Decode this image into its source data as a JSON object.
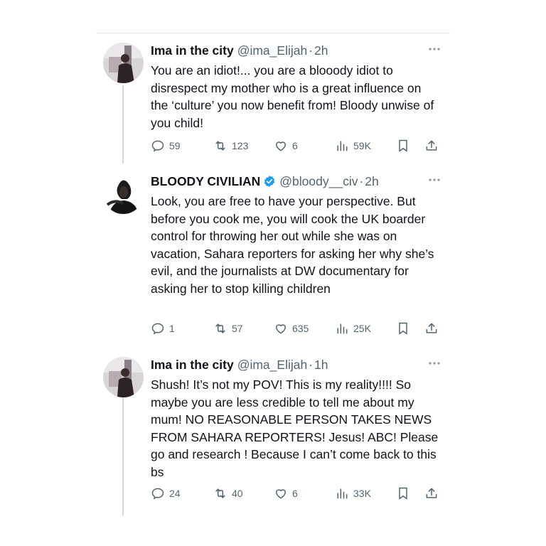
{
  "tweets": [
    {
      "name": "Ima in the city",
      "handle": "@ima_Elijah",
      "time": "2h",
      "verified": false,
      "text": "You are an idiot!... you are a blooody idiot to disrespect my mother who is a great influence on the ‘culture’ you now benefit from! Bloody unwise of you child!",
      "replies": "59",
      "reposts": "123",
      "likes": "6",
      "views": "59K"
    },
    {
      "name": "BLOODY CIVILIAN",
      "handle": "@bloody__civ",
      "time": "2h",
      "verified": true,
      "text": "Look, you are free to have your perspective. But before you cook me, you will cook the UK boarder control for throwing her out while she was on vacation, Sahara reporters for asking her why she’s evil, and the journalists at DW documentary for asking her to stop killing children",
      "replies": "1",
      "reposts": "57",
      "likes": "635",
      "views": "25K"
    },
    {
      "name": "Ima in the city",
      "handle": "@ima_Elijah",
      "time": "1h",
      "verified": false,
      "text": "Shush! It’s not my POV! This is my reality!!!! So maybe you are less credible to tell me about my mum! NO REASONABLE PERSON TAKES NEWS FROM SAHARA REPORTERS! Jesus! ABC! Please go and research ! Because I can’t come back to this bs",
      "replies": "24",
      "reposts": "40",
      "likes": "6",
      "views": "33K"
    }
  ],
  "colors": {
    "text": "#0f1419",
    "muted": "#536471",
    "verified": "#1d9bf0",
    "thread_line": "#cfd9de"
  }
}
